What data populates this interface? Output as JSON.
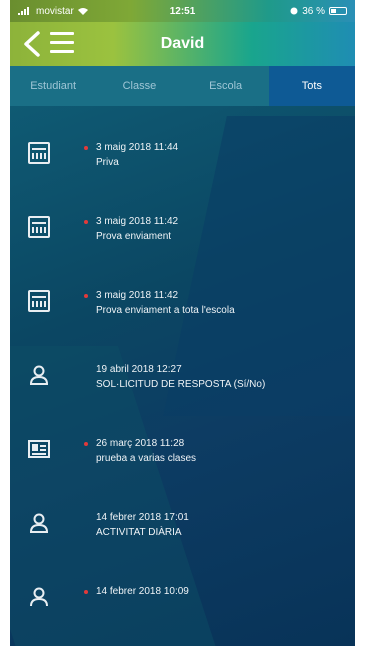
{
  "status_bar": {
    "carrier": "movistar",
    "time": "12:51",
    "battery": "36 %"
  },
  "header": {
    "title": "David",
    "back_icon": "chevron-left-icon",
    "menu_icon": "hamburger-icon"
  },
  "tabs": [
    {
      "label": "Estudiant",
      "active": false
    },
    {
      "label": "Classe",
      "active": false
    },
    {
      "label": "Escola",
      "active": false
    },
    {
      "label": "Tots",
      "active": true
    }
  ],
  "colors": {
    "accent_green": "#8db33a",
    "accent_teal": "#19a58d",
    "active_tab": "#0e5a95",
    "unread_dot": "#e23a3a"
  },
  "notifications": [
    {
      "icon": "message-icon",
      "unread": true,
      "date": "3 maig 2018 11:44",
      "subject": "Priva"
    },
    {
      "icon": "message-icon",
      "unread": true,
      "date": "3 maig 2018 11:42",
      "subject": "Prova enviament"
    },
    {
      "icon": "message-icon",
      "unread": true,
      "date": "3 maig 2018 11:42",
      "subject": "Prova enviament a tota l'escola"
    },
    {
      "icon": "person-icon",
      "unread": false,
      "date": "19 abril 2018 12:27",
      "subject": "SOL·LICITUD DE RESPOSTA (Sí/No)"
    },
    {
      "icon": "id-card-icon",
      "unread": true,
      "date": "26 març 2018 11:28",
      "subject": "prueba a varias clases"
    },
    {
      "icon": "person-icon",
      "unread": false,
      "date": "14 febrer 2018 17:01",
      "subject": "ACTIVITAT DIÀRIA"
    },
    {
      "icon": "person-icon",
      "unread": true,
      "date": "14 febrer 2018 10:09",
      "subject": ""
    }
  ]
}
